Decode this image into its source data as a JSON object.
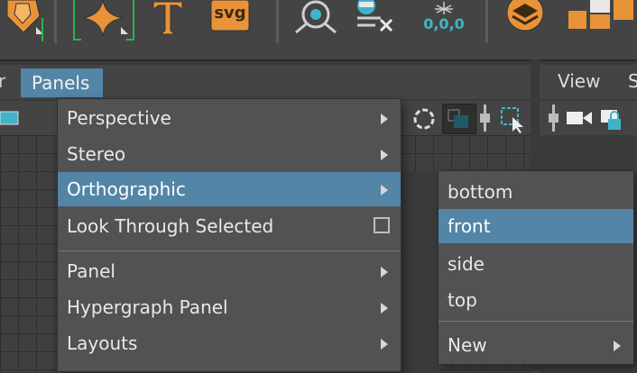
{
  "shelf": {
    "icons": [
      "polygon-platonic-icon",
      "sparkle-shape-icon",
      "text-tool-icon",
      "svg-tool-icon",
      "joint-tool-icon",
      "delete-history-icon",
      "cluster-icon",
      "layers-icon",
      "shapes-icon"
    ],
    "svg_label": "svg",
    "coord_label": "0,0,0"
  },
  "left_panel": {
    "menubar_stub": "r",
    "panels_menu_label": "Panels"
  },
  "right_panel": {
    "view_label": "View",
    "stub_label": "S"
  },
  "panels_menu": {
    "items": [
      {
        "label": "Perspective"
      },
      {
        "label": "Stereo"
      },
      {
        "label": "Orthographic"
      },
      {
        "label": "Look Through Selected"
      },
      {
        "label": "Panel"
      },
      {
        "label": "Hypergraph Panel"
      },
      {
        "label": "Layouts"
      }
    ]
  },
  "orthographic_submenu": {
    "items": [
      {
        "label": "bottom"
      },
      {
        "label": "front"
      },
      {
        "label": "side"
      },
      {
        "label": "top"
      },
      {
        "label": "New"
      }
    ]
  },
  "colors": {
    "highlight": "#5285a6",
    "menu_bg": "#525252",
    "accent_orange": "#e8933a",
    "accent_teal": "#3fb4c8"
  }
}
